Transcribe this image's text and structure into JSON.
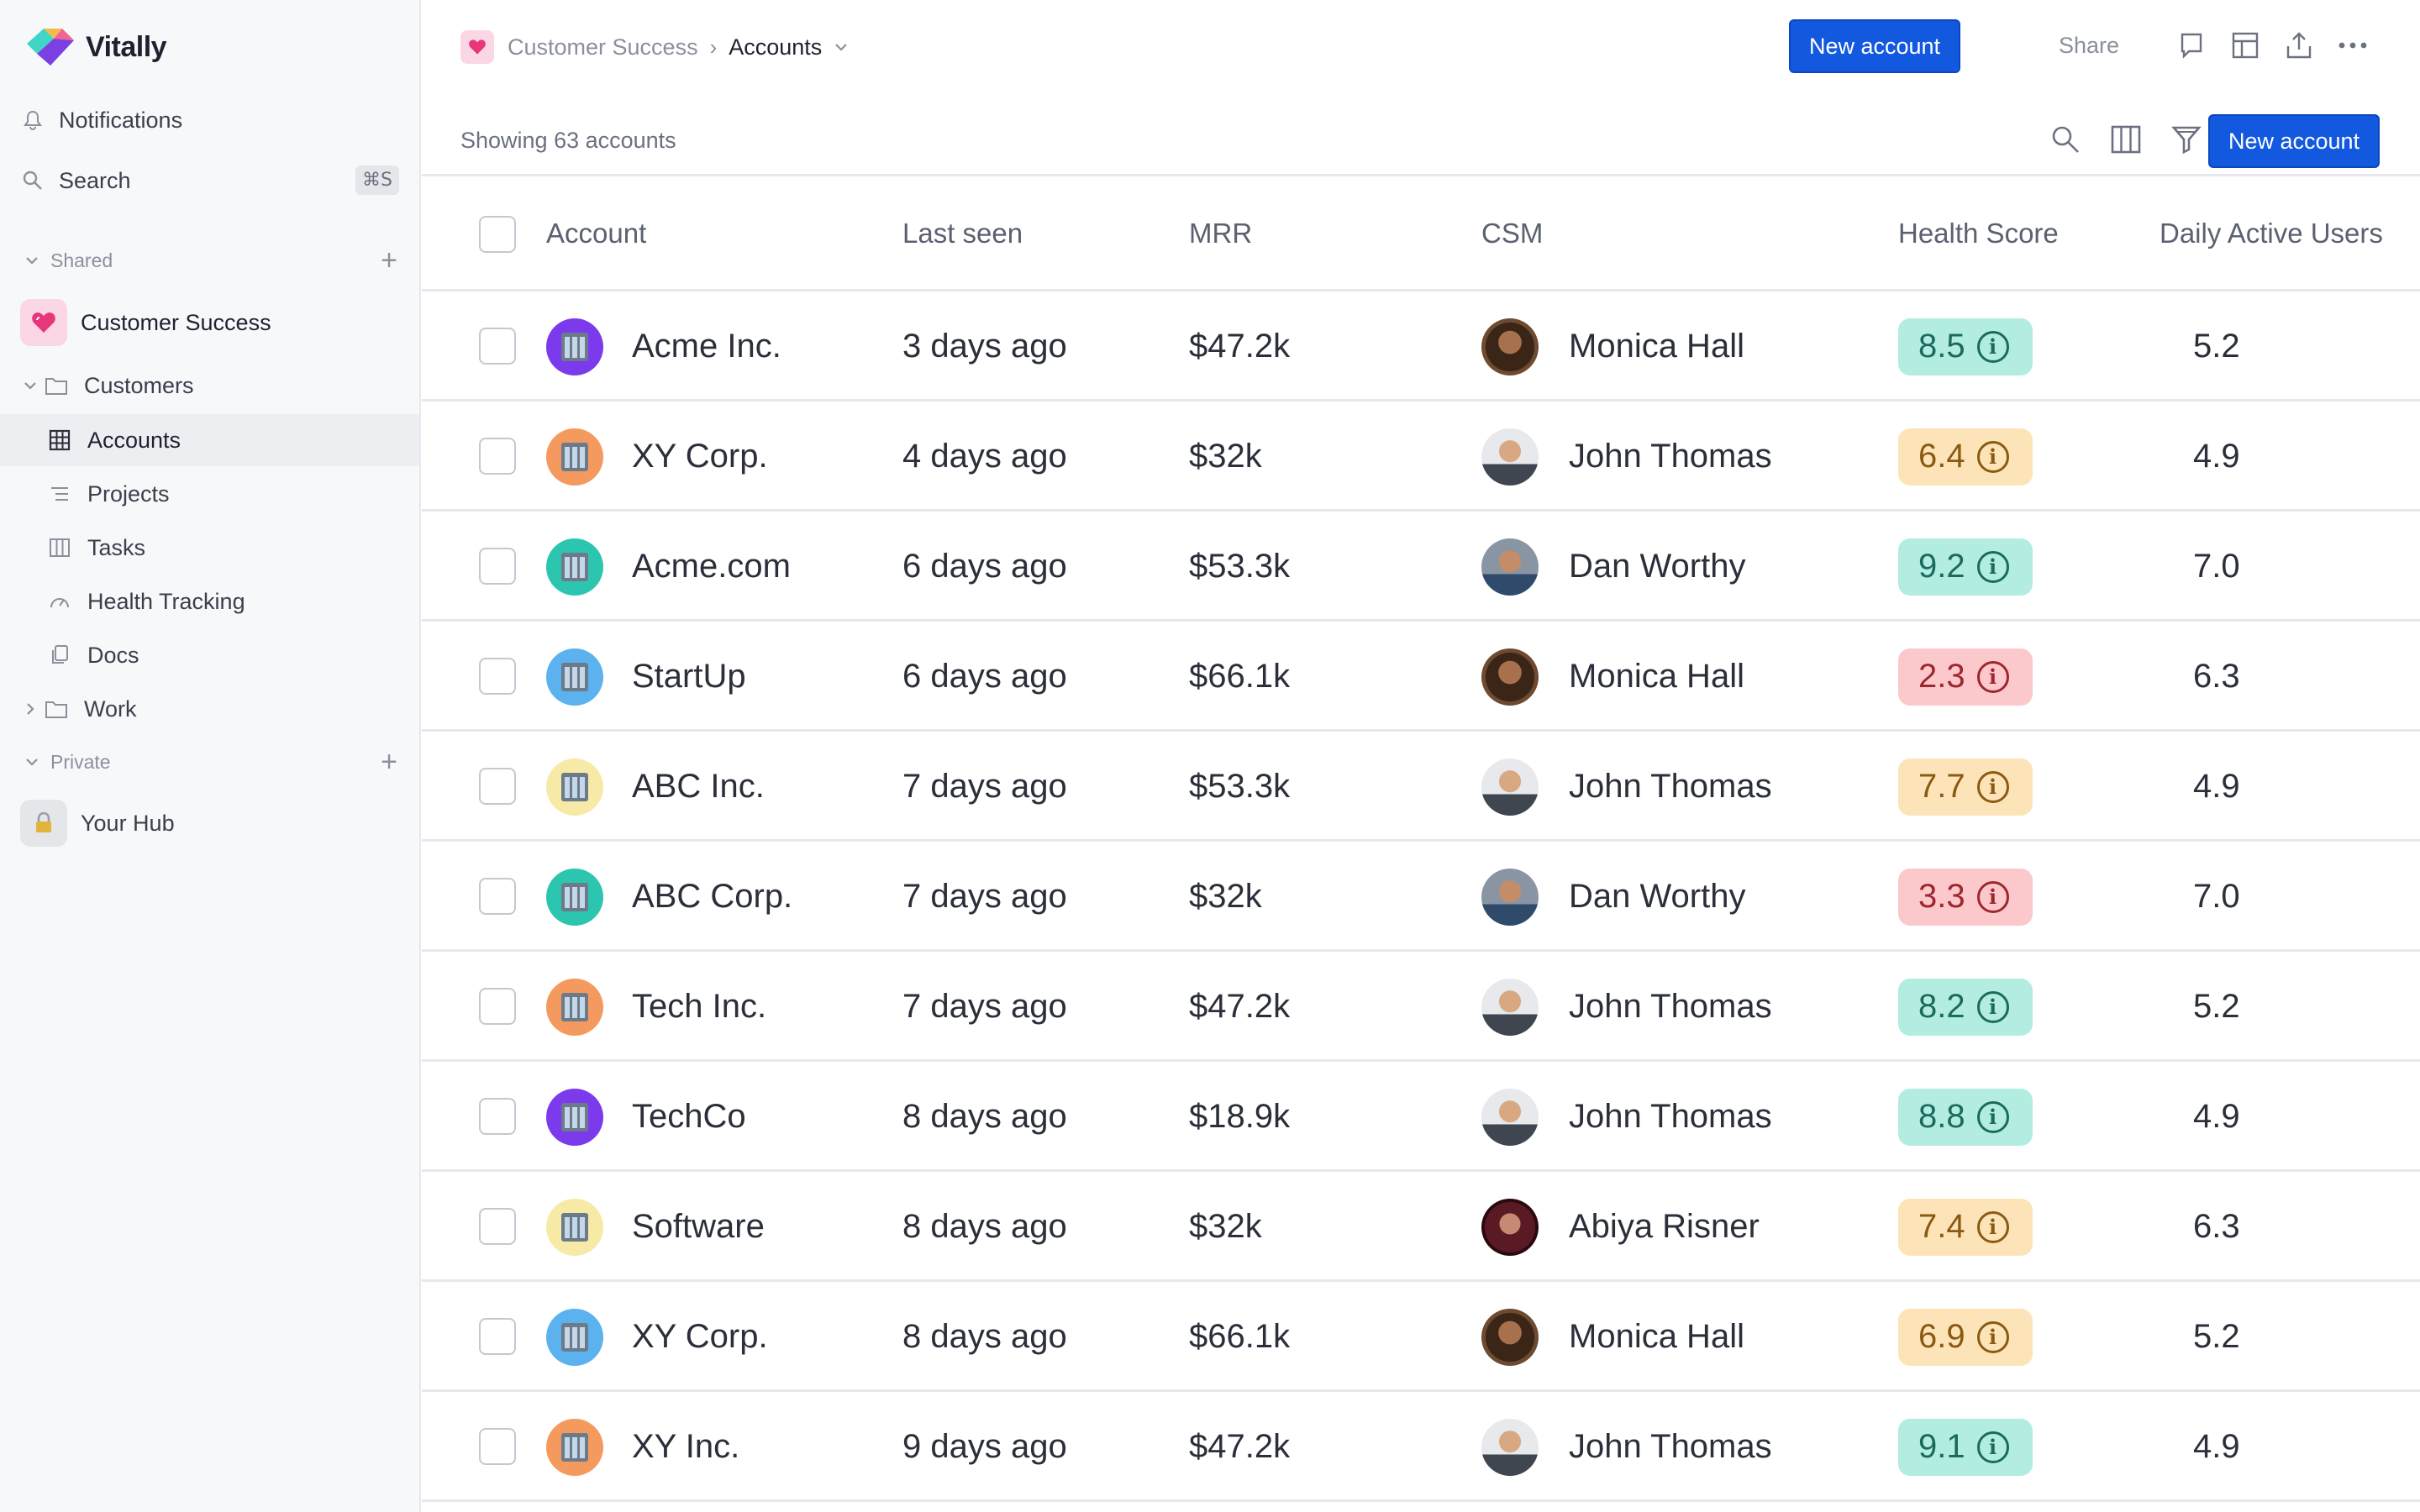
{
  "app": {
    "name": "Vitally"
  },
  "sidebar": {
    "notifications": "Notifications",
    "search": "Search",
    "search_shortcut": "⌘S",
    "shared_label": "Shared",
    "hub_name": "Customer Success",
    "customers": "Customers",
    "accounts": "Accounts",
    "projects": "Projects",
    "tasks": "Tasks",
    "health": "Health Tracking",
    "docs": "Docs",
    "work": "Work",
    "private_label": "Private",
    "your_hub": "Your Hub"
  },
  "topbar": {
    "crumb_parent": "Customer Success",
    "crumb_current": "Accounts",
    "new_account": "New account",
    "share": "Share"
  },
  "subbar": {
    "showing": "Showing 63 accounts",
    "new_account": "New account"
  },
  "table": {
    "headers": {
      "account": "Account",
      "last_seen": "Last seen",
      "mrr": "MRR",
      "csm": "CSM",
      "health": "Health Score",
      "dau": "Daily Active Users"
    },
    "rows": [
      {
        "account": "Acme Inc.",
        "icon_color": "#7c3aed",
        "last_seen": "3 days ago",
        "mrr": "$47.2k",
        "csm": "Monica Hall",
        "avatar": "monica",
        "health": "8.5",
        "health_level": "good",
        "dau": "5.2"
      },
      {
        "account": "XY Corp.",
        "icon_color": "#f59a5e",
        "last_seen": "4 days ago",
        "mrr": "$32k",
        "csm": "John Thomas",
        "avatar": "john",
        "health": "6.4",
        "health_level": "mid",
        "dau": "4.9"
      },
      {
        "account": "Acme.com",
        "icon_color": "#2cc6b0",
        "last_seen": "6 days ago",
        "mrr": "$53.3k",
        "csm": "Dan Worthy",
        "avatar": "dan",
        "health": "9.2",
        "health_level": "good",
        "dau": "7.0"
      },
      {
        "account": "StartUp",
        "icon_color": "#5bb2ee",
        "last_seen": "6 days ago",
        "mrr": "$66.1k",
        "csm": "Monica Hall",
        "avatar": "monica",
        "health": "2.3",
        "health_level": "bad",
        "dau": "6.3"
      },
      {
        "account": "ABC Inc.",
        "icon_color": "#f7eaa6",
        "last_seen": "7 days ago",
        "mrr": "$53.3k",
        "csm": "John Thomas",
        "avatar": "john",
        "health": "7.7",
        "health_level": "mid",
        "dau": "4.9"
      },
      {
        "account": "ABC Corp.",
        "icon_color": "#2cc6b0",
        "last_seen": "7 days ago",
        "mrr": "$32k",
        "csm": "Dan Worthy",
        "avatar": "dan",
        "health": "3.3",
        "health_level": "bad",
        "dau": "7.0"
      },
      {
        "account": "Tech Inc.",
        "icon_color": "#f59a5e",
        "last_seen": "7 days ago",
        "mrr": "$47.2k",
        "csm": "John Thomas",
        "avatar": "john",
        "health": "8.2",
        "health_level": "good",
        "dau": "5.2"
      },
      {
        "account": "TechCo",
        "icon_color": "#7c3aed",
        "last_seen": "8 days ago",
        "mrr": "$18.9k",
        "csm": "John Thomas",
        "avatar": "john",
        "health": "8.8",
        "health_level": "good",
        "dau": "4.9"
      },
      {
        "account": "Software",
        "icon_color": "#f7eaa6",
        "last_seen": "8 days ago",
        "mrr": "$32k",
        "csm": "Abiya Risner",
        "avatar": "abiya",
        "health": "7.4",
        "health_level": "mid",
        "dau": "6.3"
      },
      {
        "account": "XY Corp.",
        "icon_color": "#5bb2ee",
        "last_seen": "8 days ago",
        "mrr": "$66.1k",
        "csm": "Monica Hall",
        "avatar": "monica",
        "health": "6.9",
        "health_level": "mid",
        "dau": "5.2"
      },
      {
        "account": "XY Inc.",
        "icon_color": "#f59a5e",
        "last_seen": "9 days ago",
        "mrr": "$47.2k",
        "csm": "John Thomas",
        "avatar": "john",
        "health": "9.1",
        "health_level": "good",
        "dau": "4.9"
      }
    ]
  },
  "colors": {
    "primary": "#1259e0",
    "health_good_bg": "#b3ece1",
    "health_good_fg": "#1b6b5c",
    "health_mid_bg": "#fde4b8",
    "health_mid_fg": "#8a5a12",
    "health_bad_bg": "#fbc9cc",
    "health_bad_fg": "#a0262e"
  }
}
